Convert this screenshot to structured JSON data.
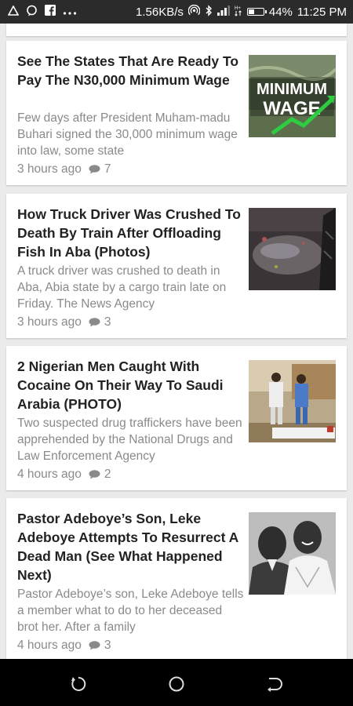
{
  "statusbar": {
    "speed": "1.56KB/s",
    "battery": "44%",
    "battery_level": 0.44,
    "time": "11:25 PM",
    "left_icons": [
      "warning-icon",
      "messenger-icon",
      "facebook-icon",
      "more-icon"
    ],
    "right_icons": [
      "hotspot-icon",
      "bluetooth-icon",
      "signal-icon",
      "data-icon",
      "battery-icon"
    ]
  },
  "articles": [
    {
      "title": "See The States That Are Ready To Pay The N30,000 Minimum Wage",
      "excerpt": "Few days after President Muham-madu Buhari signed the 30,000 minimum wage into law, some state",
      "time": "3 hours ago",
      "comments": "7",
      "image": "minimum-wage",
      "image_text": [
        "MINIMUM",
        "WAGE"
      ]
    },
    {
      "title": "How Truck Driver Was Crushed To Death By Train After Offloading Fish In Aba (Photos)",
      "excerpt": "A truck driver was crushed to death in Aba, Abia state by a cargo train late on Friday. The News Agency",
      "time": "3 hours ago",
      "comments": "3",
      "image": "train-accident"
    },
    {
      "title": "2 Nigerian Men Caught With Cocaine On Their Way To Saudi Arabia (PHOTO)",
      "excerpt": "Two suspected drug traffickers have been apprehended by the National Drugs and Law Enforcement Agency",
      "time": "4 hours ago",
      "comments": "2",
      "image": "suspects"
    },
    {
      "title": "Pastor Adeboye’s Son, Leke Adeboye Attempts To Resurrect A Dead Man (See What Happened Next)",
      "excerpt": "Pastor Adeboye’s son, Leke Adeboye tells a member what to do to her deceased brot her. After a family",
      "time": "4 hours ago",
      "comments": "3",
      "image": "adeboye-portrait"
    }
  ],
  "navbar": {
    "buttons": [
      "recent-apps-button",
      "home-button",
      "back-button"
    ]
  }
}
